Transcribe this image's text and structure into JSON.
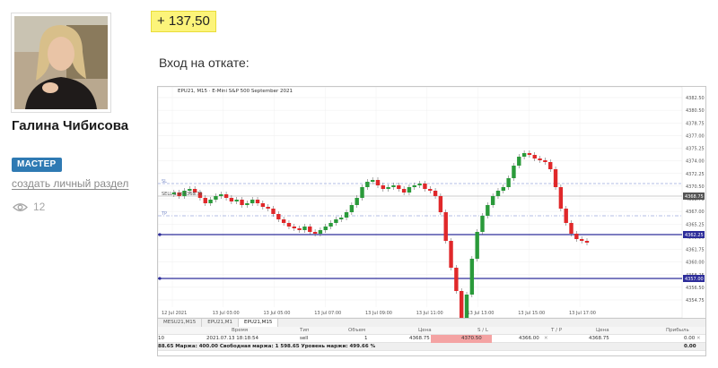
{
  "author": {
    "name": "Галина Чибисова",
    "role": "МАСТЕР",
    "personal_link": "создать личный раздел",
    "views": "12"
  },
  "post": {
    "profit": "+ 137,50",
    "caption": "Вход на откате:"
  },
  "chart": {
    "title": "EPU21, M15 · E-Mini S&P 500 September 2021",
    "symbol_label": "SELL 1 at 4368.75",
    "price_ticks": [
      "4382.50",
      "4380.50",
      "4378.75",
      "4377.00",
      "4375.25",
      "4374.00",
      "4372.25",
      "4370.50",
      "4368.75",
      "4367.00",
      "4365.25",
      "4363.50",
      "4361.75",
      "4360.00",
      "4358.25",
      "4356.50",
      "4354.75"
    ],
    "price_badges": [
      "4368.75",
      "4362.25",
      "4357.00"
    ],
    "time_ticks": [
      "12 Jul 2021",
      "13 Jul 03:00",
      "13 Jul 05:00",
      "13 Jul 07:00",
      "13 Jul 09:00",
      "13 Jul 11:00",
      "13 Jul 13:00",
      "13 Jul 15:00",
      "13 Jul 17:00"
    ]
  },
  "tabs": [
    "MESU21,M15",
    "EPU21,M1",
    "EPU21,M15"
  ],
  "active_tab": 2,
  "orders": {
    "headers": [
      "Время",
      "Тип",
      "Объем",
      "Цена",
      "S / L",
      "T / P",
      "Цена",
      "Прибыль"
    ],
    "row": {
      "id": "10",
      "time": "2021.07.13 18:18:54",
      "type": "sell",
      "volume": "1",
      "price": "4368.75",
      "sl": "4370.50",
      "tp": "4366.00",
      "current_price": "4368.75",
      "profit": "0.00"
    },
    "footer": "88.65  Маржа: 400.00  Свободная маржа: 1 598.65  Уровень маржи: 499.66 %",
    "footer_profit": "0.00"
  }
}
